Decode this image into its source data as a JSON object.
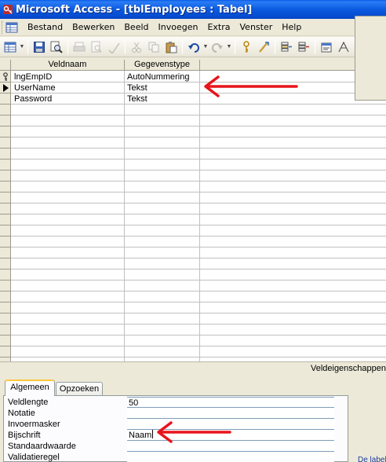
{
  "window": {
    "title": "Microsoft Access - [tblEmployees : Tabel]"
  },
  "menu": [
    "Bestand",
    "Bewerken",
    "Beeld",
    "Invoegen",
    "Extra",
    "Venster",
    "Help"
  ],
  "toolbar": {
    "icons": [
      "view-icon",
      "save-icon",
      "search-icon",
      "print-icon",
      "print-preview-icon",
      "spelling-icon",
      "cut-icon",
      "copy-icon",
      "paste-icon",
      "undo-icon",
      "redo-icon",
      "primary-key-icon",
      "build-icon",
      "insert-rows-icon",
      "delete-rows-icon",
      "properties-icon",
      "indexes-icon"
    ]
  },
  "grid": {
    "columns": [
      "Veldnaam",
      "Gegevenstype"
    ],
    "rows": [
      {
        "name": "lngEmpID",
        "type": "AutoNummering",
        "primary_key": true
      },
      {
        "name": "UserName",
        "type": "Tekst",
        "current": true
      },
      {
        "name": "Password",
        "type": "Tekst"
      }
    ]
  },
  "lower": {
    "caption": "Veldeigenschappen",
    "tabs": [
      "Algemeen",
      "Opzoeken"
    ],
    "properties": [
      {
        "label": "Veldlengte",
        "value": "50"
      },
      {
        "label": "Notatie",
        "value": ""
      },
      {
        "label": "Invoermasker",
        "value": ""
      },
      {
        "label": "Bijschrift",
        "value": "Naam"
      },
      {
        "label": "Standaardwaarde",
        "value": ""
      },
      {
        "label": "Validatieregel",
        "value": ""
      }
    ],
    "help_text": "De label"
  },
  "annotation_color": "#e8141c"
}
